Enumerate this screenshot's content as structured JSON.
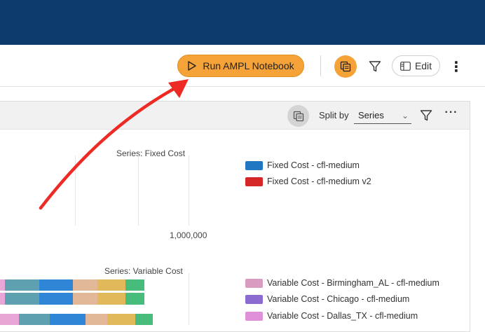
{
  "topbar": {
    "icons": [
      "clipboard-check-icon",
      "gear-icon"
    ],
    "bg_color": "#0b3b6d"
  },
  "toolbar": {
    "run_label": "Run AMPL Notebook",
    "edit_label": "Edit",
    "accent_color": "#f5a238"
  },
  "panel": {
    "split_label": "Split by",
    "split_value": "Series"
  },
  "charts": {
    "fixed": {
      "title": "Series: Fixed Cost",
      "tick_label": "1,000,000",
      "legend": [
        {
          "label": "Fixed Cost - cfl-medium",
          "color": "#1f78c1"
        },
        {
          "label": "Fixed Cost - cfl-medium v2",
          "color": "#d62728"
        }
      ]
    },
    "variable": {
      "title": "Series: Variable Cost",
      "legend": [
        {
          "label": "Variable Cost - Birmingham_AL - cfl-medium",
          "color": "#d99bc0"
        },
        {
          "label": "Variable Cost - Chicago - cfl-medium",
          "color": "#8c6bd1"
        },
        {
          "label": "Variable Cost - Dallas_TX - cfl-medium",
          "color": "#e08fd9"
        }
      ],
      "segment_colors": [
        "#e7a6d6",
        "#5fa0b0",
        "#2f86d6",
        "#e3b898",
        "#e2b95a",
        "#48bd7b"
      ]
    }
  }
}
